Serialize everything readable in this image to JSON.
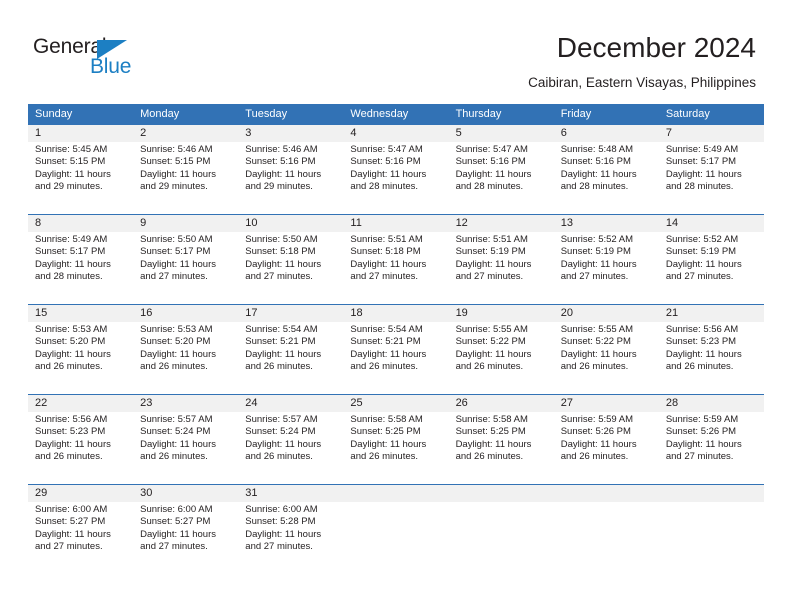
{
  "brand": {
    "name_top": "General",
    "name_bottom": "Blue",
    "accent_color": "#1c7fc3",
    "triangle_icon": "triangle-icon"
  },
  "header": {
    "title": "December 2024",
    "subtitle": "Caibiran, Eastern Visayas, Philippines"
  },
  "theme": {
    "header_blue": "#3272b5",
    "daynum_band": "#f1f1f1",
    "text": "#231f20"
  },
  "calendar": {
    "weekdays": [
      "Sunday",
      "Monday",
      "Tuesday",
      "Wednesday",
      "Thursday",
      "Friday",
      "Saturday"
    ],
    "weeks": [
      [
        {
          "day": "1",
          "sunrise": "Sunrise: 5:45 AM",
          "sunset": "Sunset: 5:15 PM",
          "daylight1": "Daylight: 11 hours",
          "daylight2": "and 29 minutes."
        },
        {
          "day": "2",
          "sunrise": "Sunrise: 5:46 AM",
          "sunset": "Sunset: 5:15 PM",
          "daylight1": "Daylight: 11 hours",
          "daylight2": "and 29 minutes."
        },
        {
          "day": "3",
          "sunrise": "Sunrise: 5:46 AM",
          "sunset": "Sunset: 5:16 PM",
          "daylight1": "Daylight: 11 hours",
          "daylight2": "and 29 minutes."
        },
        {
          "day": "4",
          "sunrise": "Sunrise: 5:47 AM",
          "sunset": "Sunset: 5:16 PM",
          "daylight1": "Daylight: 11 hours",
          "daylight2": "and 28 minutes."
        },
        {
          "day": "5",
          "sunrise": "Sunrise: 5:47 AM",
          "sunset": "Sunset: 5:16 PM",
          "daylight1": "Daylight: 11 hours",
          "daylight2": "and 28 minutes."
        },
        {
          "day": "6",
          "sunrise": "Sunrise: 5:48 AM",
          "sunset": "Sunset: 5:16 PM",
          "daylight1": "Daylight: 11 hours",
          "daylight2": "and 28 minutes."
        },
        {
          "day": "7",
          "sunrise": "Sunrise: 5:49 AM",
          "sunset": "Sunset: 5:17 PM",
          "daylight1": "Daylight: 11 hours",
          "daylight2": "and 28 minutes."
        }
      ],
      [
        {
          "day": "8",
          "sunrise": "Sunrise: 5:49 AM",
          "sunset": "Sunset: 5:17 PM",
          "daylight1": "Daylight: 11 hours",
          "daylight2": "and 28 minutes."
        },
        {
          "day": "9",
          "sunrise": "Sunrise: 5:50 AM",
          "sunset": "Sunset: 5:17 PM",
          "daylight1": "Daylight: 11 hours",
          "daylight2": "and 27 minutes."
        },
        {
          "day": "10",
          "sunrise": "Sunrise: 5:50 AM",
          "sunset": "Sunset: 5:18 PM",
          "daylight1": "Daylight: 11 hours",
          "daylight2": "and 27 minutes."
        },
        {
          "day": "11",
          "sunrise": "Sunrise: 5:51 AM",
          "sunset": "Sunset: 5:18 PM",
          "daylight1": "Daylight: 11 hours",
          "daylight2": "and 27 minutes."
        },
        {
          "day": "12",
          "sunrise": "Sunrise: 5:51 AM",
          "sunset": "Sunset: 5:19 PM",
          "daylight1": "Daylight: 11 hours",
          "daylight2": "and 27 minutes."
        },
        {
          "day": "13",
          "sunrise": "Sunrise: 5:52 AM",
          "sunset": "Sunset: 5:19 PM",
          "daylight1": "Daylight: 11 hours",
          "daylight2": "and 27 minutes."
        },
        {
          "day": "14",
          "sunrise": "Sunrise: 5:52 AM",
          "sunset": "Sunset: 5:19 PM",
          "daylight1": "Daylight: 11 hours",
          "daylight2": "and 27 minutes."
        }
      ],
      [
        {
          "day": "15",
          "sunrise": "Sunrise: 5:53 AM",
          "sunset": "Sunset: 5:20 PM",
          "daylight1": "Daylight: 11 hours",
          "daylight2": "and 26 minutes."
        },
        {
          "day": "16",
          "sunrise": "Sunrise: 5:53 AM",
          "sunset": "Sunset: 5:20 PM",
          "daylight1": "Daylight: 11 hours",
          "daylight2": "and 26 minutes."
        },
        {
          "day": "17",
          "sunrise": "Sunrise: 5:54 AM",
          "sunset": "Sunset: 5:21 PM",
          "daylight1": "Daylight: 11 hours",
          "daylight2": "and 26 minutes."
        },
        {
          "day": "18",
          "sunrise": "Sunrise: 5:54 AM",
          "sunset": "Sunset: 5:21 PM",
          "daylight1": "Daylight: 11 hours",
          "daylight2": "and 26 minutes."
        },
        {
          "day": "19",
          "sunrise": "Sunrise: 5:55 AM",
          "sunset": "Sunset: 5:22 PM",
          "daylight1": "Daylight: 11 hours",
          "daylight2": "and 26 minutes."
        },
        {
          "day": "20",
          "sunrise": "Sunrise: 5:55 AM",
          "sunset": "Sunset: 5:22 PM",
          "daylight1": "Daylight: 11 hours",
          "daylight2": "and 26 minutes."
        },
        {
          "day": "21",
          "sunrise": "Sunrise: 5:56 AM",
          "sunset": "Sunset: 5:23 PM",
          "daylight1": "Daylight: 11 hours",
          "daylight2": "and 26 minutes."
        }
      ],
      [
        {
          "day": "22",
          "sunrise": "Sunrise: 5:56 AM",
          "sunset": "Sunset: 5:23 PM",
          "daylight1": "Daylight: 11 hours",
          "daylight2": "and 26 minutes."
        },
        {
          "day": "23",
          "sunrise": "Sunrise: 5:57 AM",
          "sunset": "Sunset: 5:24 PM",
          "daylight1": "Daylight: 11 hours",
          "daylight2": "and 26 minutes."
        },
        {
          "day": "24",
          "sunrise": "Sunrise: 5:57 AM",
          "sunset": "Sunset: 5:24 PM",
          "daylight1": "Daylight: 11 hours",
          "daylight2": "and 26 minutes."
        },
        {
          "day": "25",
          "sunrise": "Sunrise: 5:58 AM",
          "sunset": "Sunset: 5:25 PM",
          "daylight1": "Daylight: 11 hours",
          "daylight2": "and 26 minutes."
        },
        {
          "day": "26",
          "sunrise": "Sunrise: 5:58 AM",
          "sunset": "Sunset: 5:25 PM",
          "daylight1": "Daylight: 11 hours",
          "daylight2": "and 26 minutes."
        },
        {
          "day": "27",
          "sunrise": "Sunrise: 5:59 AM",
          "sunset": "Sunset: 5:26 PM",
          "daylight1": "Daylight: 11 hours",
          "daylight2": "and 26 minutes."
        },
        {
          "day": "28",
          "sunrise": "Sunrise: 5:59 AM",
          "sunset": "Sunset: 5:26 PM",
          "daylight1": "Daylight: 11 hours",
          "daylight2": "and 27 minutes."
        }
      ],
      [
        {
          "day": "29",
          "sunrise": "Sunrise: 6:00 AM",
          "sunset": "Sunset: 5:27 PM",
          "daylight1": "Daylight: 11 hours",
          "daylight2": "and 27 minutes."
        },
        {
          "day": "30",
          "sunrise": "Sunrise: 6:00 AM",
          "sunset": "Sunset: 5:27 PM",
          "daylight1": "Daylight: 11 hours",
          "daylight2": "and 27 minutes."
        },
        {
          "day": "31",
          "sunrise": "Sunrise: 6:00 AM",
          "sunset": "Sunset: 5:28 PM",
          "daylight1": "Daylight: 11 hours",
          "daylight2": "and 27 minutes."
        },
        {
          "day": "",
          "sunrise": "",
          "sunset": "",
          "daylight1": "",
          "daylight2": ""
        },
        {
          "day": "",
          "sunrise": "",
          "sunset": "",
          "daylight1": "",
          "daylight2": ""
        },
        {
          "day": "",
          "sunrise": "",
          "sunset": "",
          "daylight1": "",
          "daylight2": ""
        },
        {
          "day": "",
          "sunrise": "",
          "sunset": "",
          "daylight1": "",
          "daylight2": ""
        }
      ]
    ]
  }
}
